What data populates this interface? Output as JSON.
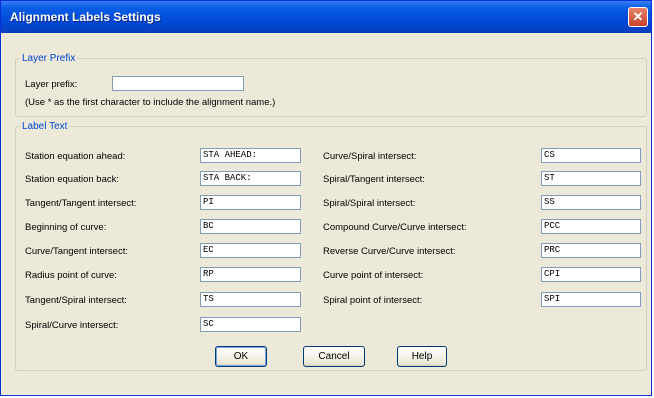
{
  "window": {
    "title": "Alignment Labels Settings",
    "close_glyph": "✕"
  },
  "layer_prefix": {
    "legend": "Layer Prefix",
    "label": "Layer prefix:",
    "value": "",
    "note": "(Use * as the first character to include the alignment name.)"
  },
  "label_text": {
    "legend": "Label Text",
    "left": [
      {
        "label": "Station equation ahead:",
        "value": "STA AHEAD:"
      },
      {
        "label": "Station equation back:",
        "value": "STA BACK:"
      },
      {
        "label": "Tangent/Tangent intersect:",
        "value": "PI"
      },
      {
        "label": "Beginning of curve:",
        "value": "BC"
      },
      {
        "label": "Curve/Tangent intersect:",
        "value": "EC"
      },
      {
        "label": "Radius point of curve:",
        "value": "RP"
      },
      {
        "label": "Tangent/Spiral intersect:",
        "value": "TS"
      },
      {
        "label": "Spiral/Curve intersect:",
        "value": "SC"
      }
    ],
    "right": [
      {
        "label": "Curve/Spiral intersect:",
        "value": "CS"
      },
      {
        "label": "Spiral/Tangent intersect:",
        "value": "ST"
      },
      {
        "label": "Spiral/Spiral intersect:",
        "value": "SS"
      },
      {
        "label": "Compound Curve/Curve intersect:",
        "value": "PCC"
      },
      {
        "label": "Reverse Curve/Curve intersect:",
        "value": "PRC"
      },
      {
        "label": "Curve point of intersect:",
        "value": "CPI"
      },
      {
        "label": "Spiral point of intersect:",
        "value": "SPI"
      }
    ]
  },
  "buttons": {
    "ok": "OK",
    "cancel": "Cancel",
    "help": "Help"
  }
}
